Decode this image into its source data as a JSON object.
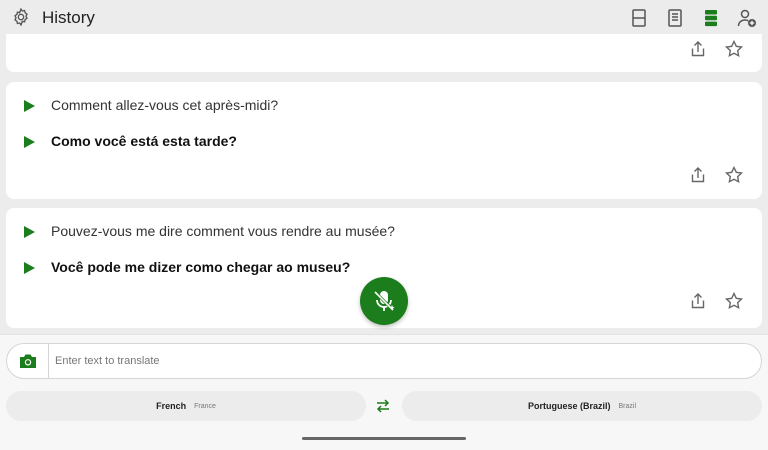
{
  "header": {
    "title": "History",
    "icons": [
      "gear-icon",
      "split-view-icon",
      "document-view-icon",
      "list-view-icon",
      "account-add-icon"
    ],
    "active_icon": "list-view-icon"
  },
  "history": {
    "items": [
      {
        "source_text": "Comment allez-vous cet après-midi?",
        "translated_text": "Como você está esta tarde?"
      },
      {
        "source_text": "Pouvez-vous me dire comment vous rendre au musée?",
        "translated_text": "Você pode me dizer como chegar ao museu?"
      }
    ],
    "item_actions": [
      "share-icon",
      "star-icon"
    ]
  },
  "input": {
    "placeholder": "Enter text to translate",
    "value": ""
  },
  "languages": {
    "source": {
      "name": "French",
      "region": "France"
    },
    "target": {
      "name": "Portuguese (Brazil)",
      "region": "Brazil"
    }
  },
  "colors": {
    "accent": "#1b7d1b",
    "card_bg": "#ffffff",
    "page_bg": "#ececec"
  }
}
